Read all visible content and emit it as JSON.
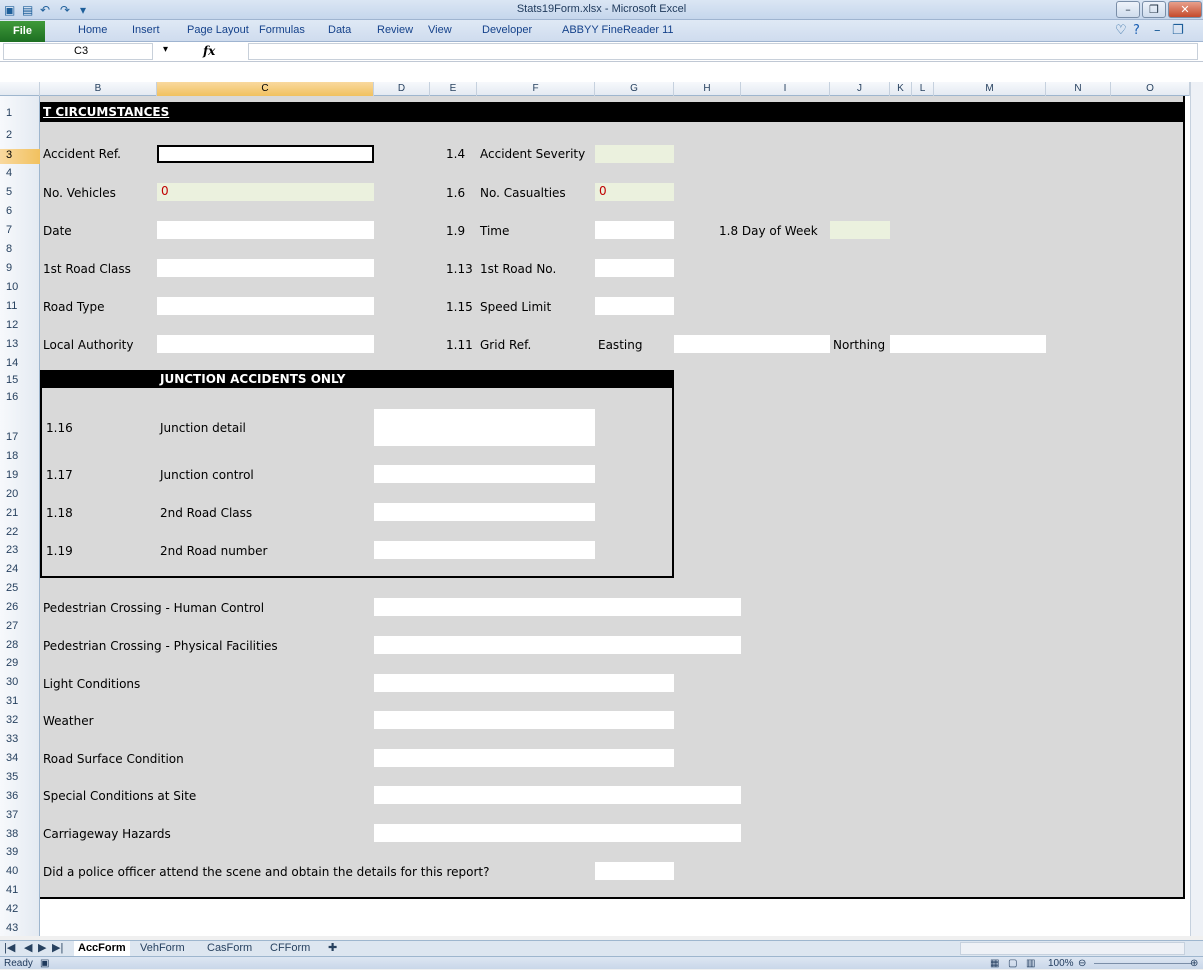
{
  "window": {
    "title": "Stats19Form.xlsx - Microsoft Excel",
    "controls": [
      "minimize-icon",
      "restore-icon",
      "close-icon"
    ]
  },
  "ribbon": {
    "file": "File",
    "tabs": [
      "Home",
      "Insert",
      "Page Layout",
      "Formulas",
      "Data",
      "Review",
      "View",
      "Developer",
      "ABBYY FineReader 11"
    ]
  },
  "formula_bar": {
    "name_box": "C3",
    "fx": "fx",
    "value": ""
  },
  "columns": [
    "B",
    "C",
    "D",
    "E",
    "F",
    "G",
    "H",
    "I",
    "J",
    "K",
    "L",
    "M",
    "N",
    "O"
  ],
  "rows": [
    "1",
    "2",
    "3",
    "4",
    "5",
    "6",
    "7",
    "8",
    "9",
    "10",
    "11",
    "12",
    "13",
    "14",
    "15",
    "16",
    "17",
    "18",
    "19",
    "20",
    "21",
    "22",
    "23",
    "24",
    "25",
    "26",
    "27",
    "28",
    "29",
    "30",
    "31",
    "32",
    "33",
    "34",
    "35",
    "36",
    "37",
    "38",
    "39",
    "40",
    "41",
    "42",
    "43"
  ],
  "selected": {
    "column": "C",
    "row": "3"
  },
  "form": {
    "section_title": "T CIRCUMSTANCES",
    "accident_ref": "Accident Ref.",
    "accident_severity_num": "1.4",
    "accident_severity": "Accident Severity",
    "no_vehicles": "No. Vehicles",
    "no_vehicles_val": "0",
    "no_casualties_num": "1.6",
    "no_casualties": "No. Casualties",
    "no_casualties_val": "0",
    "date": "Date",
    "time_num": "1.9",
    "time": "Time",
    "day_of_week": "1.8 Day of Week",
    "road_class_1": "1st Road Class",
    "road_no_1_num": "1.13",
    "road_no_1": "1st Road No.",
    "road_type": "Road Type",
    "speed_limit_num": "1.15",
    "speed_limit": "Speed Limit",
    "local_authority": "Local Authority",
    "grid_ref_num": "1.11",
    "grid_ref": "Grid Ref.",
    "easting": "Easting",
    "northing": "Northing"
  },
  "junction": {
    "title": "JUNCTION ACCIDENTS ONLY",
    "items": [
      {
        "num": "1.16",
        "label": "Junction detail"
      },
      {
        "num": "1.17",
        "label": "Junction control"
      },
      {
        "num": "1.18",
        "label": "2nd Road Class"
      },
      {
        "num": "1.19",
        "label": "2nd Road number"
      }
    ]
  },
  "conditions": {
    "ped_human": "Pedestrian Crossing - Human Control",
    "ped_physical": "Pedestrian Crossing - Physical Facilities",
    "light": "Light Conditions",
    "weather": "Weather",
    "road_surface": "Road Surface Condition",
    "special": "Special Conditions at Site",
    "hazards": "Carriageway Hazards",
    "police": "Did a police officer attend the scene and obtain the details for this report?"
  },
  "sheet_tabs": [
    "AccForm",
    "VehForm",
    "CasForm",
    "CFForm"
  ],
  "status": {
    "ready": "Ready",
    "zoom": "100%"
  }
}
